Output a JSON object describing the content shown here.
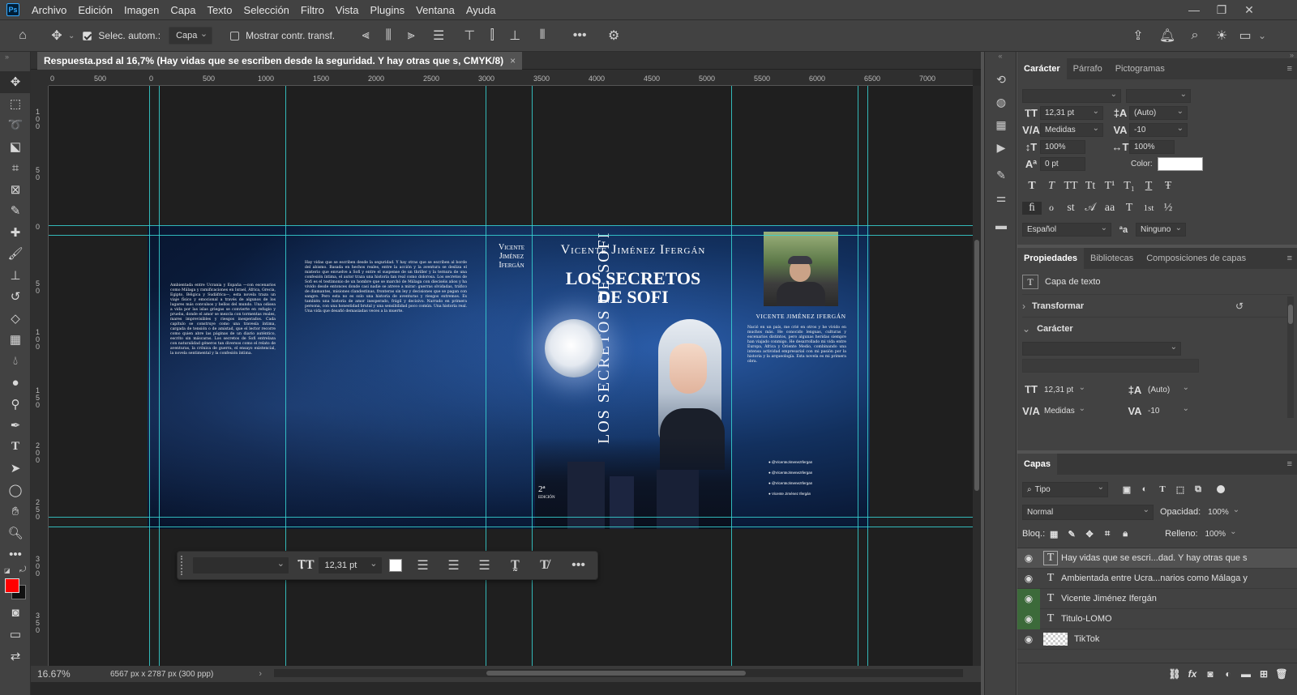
{
  "menubar": {
    "logo": "Ps",
    "items": [
      "Archivo",
      "Edición",
      "Imagen",
      "Capa",
      "Texto",
      "Selección",
      "Filtro",
      "Vista",
      "Plugins",
      "Ventana",
      "Ayuda"
    ],
    "window_controls": [
      "—",
      "❐",
      "✕"
    ]
  },
  "options": {
    "auto_select_label": "Selec. autom.:",
    "auto_select_checked": true,
    "auto_select_target": "Capa",
    "show_transform_label": "Mostrar contr. transf.",
    "show_transform_checked": false
  },
  "document": {
    "tab_title": "Respuesta.psd al 16,7% (Hay vidas que se escriben desde la seguridad. Y hay otras que s, CMYK/8)",
    "close": "×",
    "ruler_h": [
      "0",
      "500",
      "0",
      "500",
      "1000",
      "1500",
      "2000",
      "2500",
      "3000",
      "3500",
      "4000",
      "4500",
      "5000",
      "5500",
      "6000",
      "6500",
      "7000"
    ],
    "ruler_v": [
      "1 0 0",
      "5 0",
      "0",
      "5 0",
      "1 0 0",
      "1 5 0",
      "2 0 0",
      "2 5 0",
      "3 0 0",
      "3 5 0"
    ]
  },
  "cover": {
    "author_spine": "Vicente Jiménez Ifergán",
    "title_spine": "LOS SECRETOS DE SOFI",
    "author_front": "Vicente Jiménez Ifergán",
    "title_front_1": "LOS SECRETOS",
    "title_front_2": "DE SOFI",
    "edition": "2ª",
    "edition_label": "EDICIÓN",
    "flap_author": "VICENTE JIMÉNEZ IFERGÁN",
    "back_left": "Ambientada entre Ucrania y España —con escenarios como Málaga y ramificaciones en Israel, África, Grecia, Egipto, Bélgica y Sudáfrica—, esta novela traza un viaje físico y emocional a través de algunos de los lugares más convulsos y bellos del mundo. Una odisea a vida por las islas griegas se convierte en refugio y prueba, donde el amor se mezcla con tormentas reales, mares imprevisibles y riesgos inesperados. Cada capítulo se construye como una travesía íntima, cargada de tensión o de amistad, que el lector recorre como quien abre las páginas de un diario auténtico, escrito sin máscaras. Los secretos de Sofi entrelaza con naturalidad géneros tan diversos como el relato de aventuras, la crónica de guerra, el ensayo existencial, la novela sentimental y la confesión íntima.",
    "back_right": "Hay vidas que se escriben desde la seguridad. Y hay otras que se escriben al borde del abismo. Basada en hechos reales, entre la acción y la aventura se desliza el misterio que envuelve a Sofi y entre el suspense de un thriller y la ternura de una confesión íntima, el autor traza una historia tan real como dolorosa. Los secretos de Sofi es el testimonio de un hombre que se marchó de Málaga con dieciséis años y ha vivido desde entonces donde casi nadie se atreve a mirar: guerras olvidadas, tráfico de diamantes, misiones clandestinas, fronteras sin ley y decisiones que se pagan con sangre. Pero esta no es solo una historia de aventuras y riesgos extremos. Es también una historia de amor inesperado, frágil y decisivo. Narrado en primera persona, con una honestidad brutal y una sensibilidad poco común. Una historia real. Una vida que desafió demasiadas veces a la muerte.",
    "flap_bio": "Nació en un país, me crié en otros y he vivido en muchos más. He conocido lenguas, culturas y escenarios distintos, pero algunas heridas siempre han viajado conmigo. He desarrollado mi vida entre Europa, África y Oriente Medio, combinando una intensa actividad empresarial con mi pasión por la historia y la arqueología. Esta novela es mi primera obra.",
    "socials": [
      "@VicenteJimenezIfergan",
      "@VicenteJimenezIfergan",
      "@VicenteJimenezIfergan",
      "Vicente Jiménez Ifergán"
    ]
  },
  "floatbar": {
    "font_size": "12,31 pt"
  },
  "status": {
    "zoom": "16.67%",
    "doc_info": "6567 px x 2787 px (300 ppp)"
  },
  "character_panel": {
    "tabs": [
      "Carácter",
      "Párrafo",
      "Pictogramas"
    ],
    "font_size": "12,31 pt",
    "leading": "(Auto)",
    "kerning": "Medidas",
    "tracking": "-10",
    "vscale": "100%",
    "hscale": "100%",
    "baseline": "0 pt",
    "color_label": "Color:",
    "language": "Español",
    "antialias_icon": "ªa",
    "antialias": "Ninguno",
    "style_buttons": [
      "T",
      "T",
      "TT",
      "Tt",
      "T¹",
      "T₁",
      "T",
      "Ŧ"
    ],
    "opentype_buttons": [
      "ﬁ",
      "ℴ",
      "st",
      "𝒜",
      "aa",
      "T",
      "1st",
      "½"
    ]
  },
  "properties_panel": {
    "tabs": [
      "Propiedades",
      "Bibliotecas",
      "Composiciones de capas"
    ],
    "layer_kind": "Capa de texto",
    "transform_label": "Transformar",
    "character_label": "Carácter",
    "font_size": "12,31 pt",
    "leading": "(Auto)",
    "kerning": "Medidas",
    "tracking": "-10"
  },
  "layers_panel": {
    "title": "Capas",
    "filter": "Tipo",
    "blend_mode": "Normal",
    "opacity_label": "Opacidad:",
    "opacity": "100%",
    "lock_label": "Bloq.:",
    "fill_label": "Relleno:",
    "fill": "100%",
    "layers": [
      {
        "name": "Hay vidas que se escri...dad. Y hay otras que s",
        "type": "T",
        "selected": true,
        "eye_green": false
      },
      {
        "name": "Ambientada entre Ucra...narios como Málaga y",
        "type": "T",
        "selected": false,
        "eye_green": false
      },
      {
        "name": "Vicente Jiménez Ifergán",
        "type": "T",
        "selected": false,
        "eye_green": true
      },
      {
        "name": "Titulo-LOMO",
        "type": "T",
        "selected": false,
        "eye_green": true
      },
      {
        "name": "TikTok",
        "type": "img",
        "selected": false,
        "eye_green": false
      }
    ]
  },
  "colors": {
    "foreground": "#ff0000",
    "background": "#111111",
    "guide": "#37d4d4"
  }
}
